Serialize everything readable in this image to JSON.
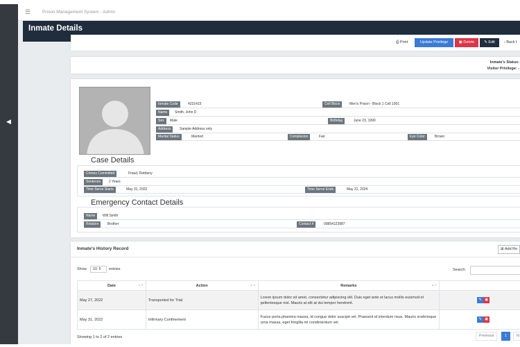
{
  "app": {
    "title": "Prison Management System - Admin",
    "page_title": "Inmate Details"
  },
  "toolbar": {
    "print": "Print",
    "update_privilege": "Update Privilege",
    "delete": "Delete",
    "edit": "Edit",
    "back": "Back t"
  },
  "status": {
    "inmate_status_label": "Inmate's Status:",
    "visitor_privilege_label": "Visitor Privilege: -"
  },
  "inmate": {
    "code_label": "Inmate Code",
    "code": "4231415",
    "cell_block_label": "Cell Block",
    "cell_block": "Men's Prison - Block 1 Cell 1001",
    "name_label": "Name",
    "name": "Smith, John D",
    "sex_label": "Sex",
    "sex": "Male",
    "birthday_label": "Birthday",
    "birthday": "June 23, 1990",
    "address_label": "Address",
    "address": "Sample Address only",
    "marital_label": "Marital Status",
    "marital": "Married",
    "complexion_label": "Complexion",
    "complexion": "Fair",
    "eye_label": "Eye Color",
    "eye": "Brown"
  },
  "case": {
    "title": "Case Details",
    "crimes_label": "Crimes Committed",
    "crimes": "Fraud, Robbery",
    "sentence_label": "Sentence",
    "sentence": "2 Years",
    "start_label": "Time Serve Starts",
    "start": "May 31, 2022",
    "end_label": "Time Serve Ends",
    "end": "May 31, 2024"
  },
  "emergency": {
    "title": "Emergency Contact Details",
    "name_label": "Name",
    "name": "Will Smith",
    "relation_label": "Relation",
    "relation": "Brother",
    "contact_label": "Contact #",
    "contact": "09854123987"
  },
  "history": {
    "title": "Inmate's History Record",
    "add_button": "Add Re",
    "show_label": "Show",
    "entries_value": "10",
    "entries_label": "entries",
    "search_label": "Search:",
    "columns": [
      "Date",
      "Action",
      "Remarks"
    ],
    "rows": [
      {
        "date": "May 27, 2022",
        "action": "Transported for Trial",
        "remarks": "Lorem ipsum dolor sit amet, consectetur adipiscing elit. Duis eget ante et lacus mollis euismod et pellentesque nisl. Mauris at elit at dui tempor hendrerit."
      },
      {
        "date": "May 31, 2022",
        "action": "Infirmary Confinement",
        "remarks": "Fusce porta pharetra massa, id congue dolor suscipit vel. Praesent id interdum risus. Mauris scelerisque urna massa, eget fringilla mi condimentum vel."
      }
    ],
    "showing": "Showing 1 to 2 of 2 entries",
    "previous": "Previous",
    "page": "1",
    "next": "N"
  },
  "colors": {
    "sidebar": "#343a40",
    "header": "#1f2d3d",
    "primary": "#3a7bd5",
    "danger": "#dc3545",
    "label": "#6c757d"
  }
}
